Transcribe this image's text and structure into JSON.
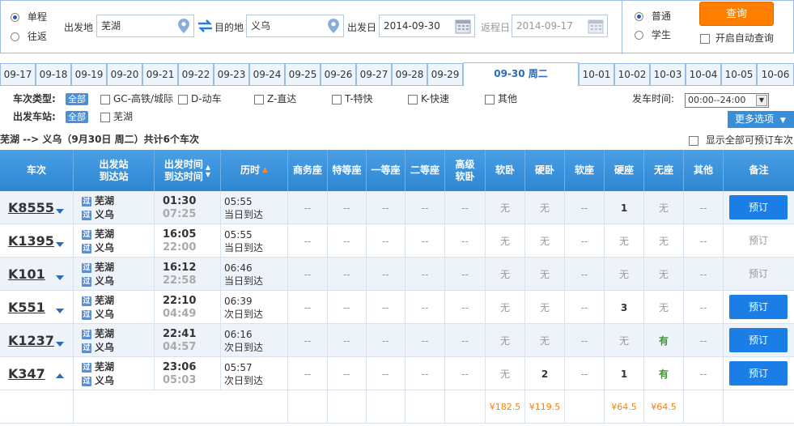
{
  "search": {
    "trip_single": "单程",
    "trip_round": "往返",
    "from_label": "出发地",
    "from_value": "芜湖",
    "to_label": "目的地",
    "to_value": "义乌",
    "depart_label": "出发日",
    "depart_value": "2014-09-30",
    "return_label": "返程日",
    "return_value": "2014-09-17",
    "type_normal": "普通",
    "type_student": "学生",
    "query_label": "查询",
    "auto_query_label": "开启自动查询"
  },
  "dates": [
    "09-17",
    "09-18",
    "09-19",
    "09-20",
    "09-21",
    "09-22",
    "09-23",
    "09-24",
    "09-25",
    "09-26",
    "09-27",
    "09-28",
    "09-29",
    "09-30 周二",
    "10-01",
    "10-02",
    "10-03",
    "10-04",
    "10-05",
    "10-06"
  ],
  "filters": {
    "train_type_label": "车次类型:",
    "all": "全部",
    "types": [
      "GC-高铁/城际",
      "D-动车",
      "Z-直达",
      "T-特快",
      "K-快速",
      "其他"
    ],
    "station_label": "出发车站:",
    "stations": [
      "芜湖"
    ],
    "time_label": "发车时间:",
    "time_value": "00:00--24:00",
    "more_label": "更多选项"
  },
  "route": {
    "text": "芜湖 --> 义乌（9月30日  周二）共计",
    "count": "6",
    "suffix": "个车次",
    "show_all": "显示全部可预订车次"
  },
  "table": {
    "headers": {
      "train": "车次",
      "station_a": "出发站",
      "station_b": "到达站",
      "time_a": "出发时间",
      "time_b": "到达时间",
      "duration": "历时",
      "business": "商务座",
      "special": "特等座",
      "first": "一等座",
      "second": "二等座",
      "hs_a": "高级",
      "hs_b": "软卧",
      "soft_sleeper": "软卧",
      "hard_sleeper": "硬卧",
      "soft_seat": "软座",
      "hard_seat": "硬座",
      "no_seat": "无座",
      "other": "其他",
      "remark": "备注"
    },
    "rows": [
      {
        "train": "K8555",
        "from": "芜湖",
        "to": "义乌",
        "dep": "01:30",
        "arr": "07:25",
        "dur": "05:55",
        "arrive_day": "当日到达",
        "seats": [
          "--",
          "--",
          "--",
          "--",
          "--",
          "无",
          "无",
          "--",
          "1",
          "无",
          "--"
        ],
        "book": "预订",
        "bookable": true,
        "expand": "down"
      },
      {
        "train": "K1395",
        "from": "芜湖",
        "to": "义乌",
        "dep": "16:05",
        "arr": "22:00",
        "dur": "05:55",
        "arrive_day": "当日到达",
        "seats": [
          "--",
          "--",
          "--",
          "--",
          "--",
          "无",
          "无",
          "--",
          "无",
          "无",
          "--"
        ],
        "book": "预订",
        "bookable": false,
        "expand": "down"
      },
      {
        "train": "K101",
        "from": "芜湖",
        "to": "义乌",
        "dep": "16:12",
        "arr": "22:58",
        "dur": "06:46",
        "arrive_day": "当日到达",
        "seats": [
          "--",
          "--",
          "--",
          "--",
          "--",
          "无",
          "无",
          "--",
          "无",
          "无",
          "--"
        ],
        "book": "预订",
        "bookable": false,
        "expand": "down"
      },
      {
        "train": "K551",
        "from": "芜湖",
        "to": "义乌",
        "dep": "22:10",
        "arr": "04:49",
        "dur": "06:39",
        "arrive_day": "次日到达",
        "seats": [
          "--",
          "--",
          "--",
          "--",
          "--",
          "无",
          "无",
          "--",
          "3",
          "无",
          "--"
        ],
        "book": "预订",
        "bookable": true,
        "expand": "down"
      },
      {
        "train": "K1237",
        "from": "芜湖",
        "to": "义乌",
        "dep": "22:41",
        "arr": "04:57",
        "dur": "06:16",
        "arrive_day": "次日到达",
        "seats": [
          "--",
          "--",
          "--",
          "--",
          "--",
          "无",
          "无",
          "--",
          "无",
          "有",
          "--"
        ],
        "book": "预订",
        "bookable": true,
        "expand": "down"
      },
      {
        "train": "K347",
        "from": "芜湖",
        "to": "义乌",
        "dep": "23:06",
        "arr": "05:03",
        "dur": "05:57",
        "arrive_day": "次日到达",
        "seats": [
          "--",
          "--",
          "--",
          "--",
          "--",
          "无",
          "2",
          "--",
          "1",
          "有",
          "--"
        ],
        "book": "预订",
        "bookable": true,
        "expand": "up"
      }
    ],
    "prices": {
      "soft_sleeper": "¥182.5",
      "hard_sleeper": "¥119.5",
      "hard_seat": "¥64.5",
      "no_seat": "¥64.5"
    },
    "station_tag": "过"
  }
}
